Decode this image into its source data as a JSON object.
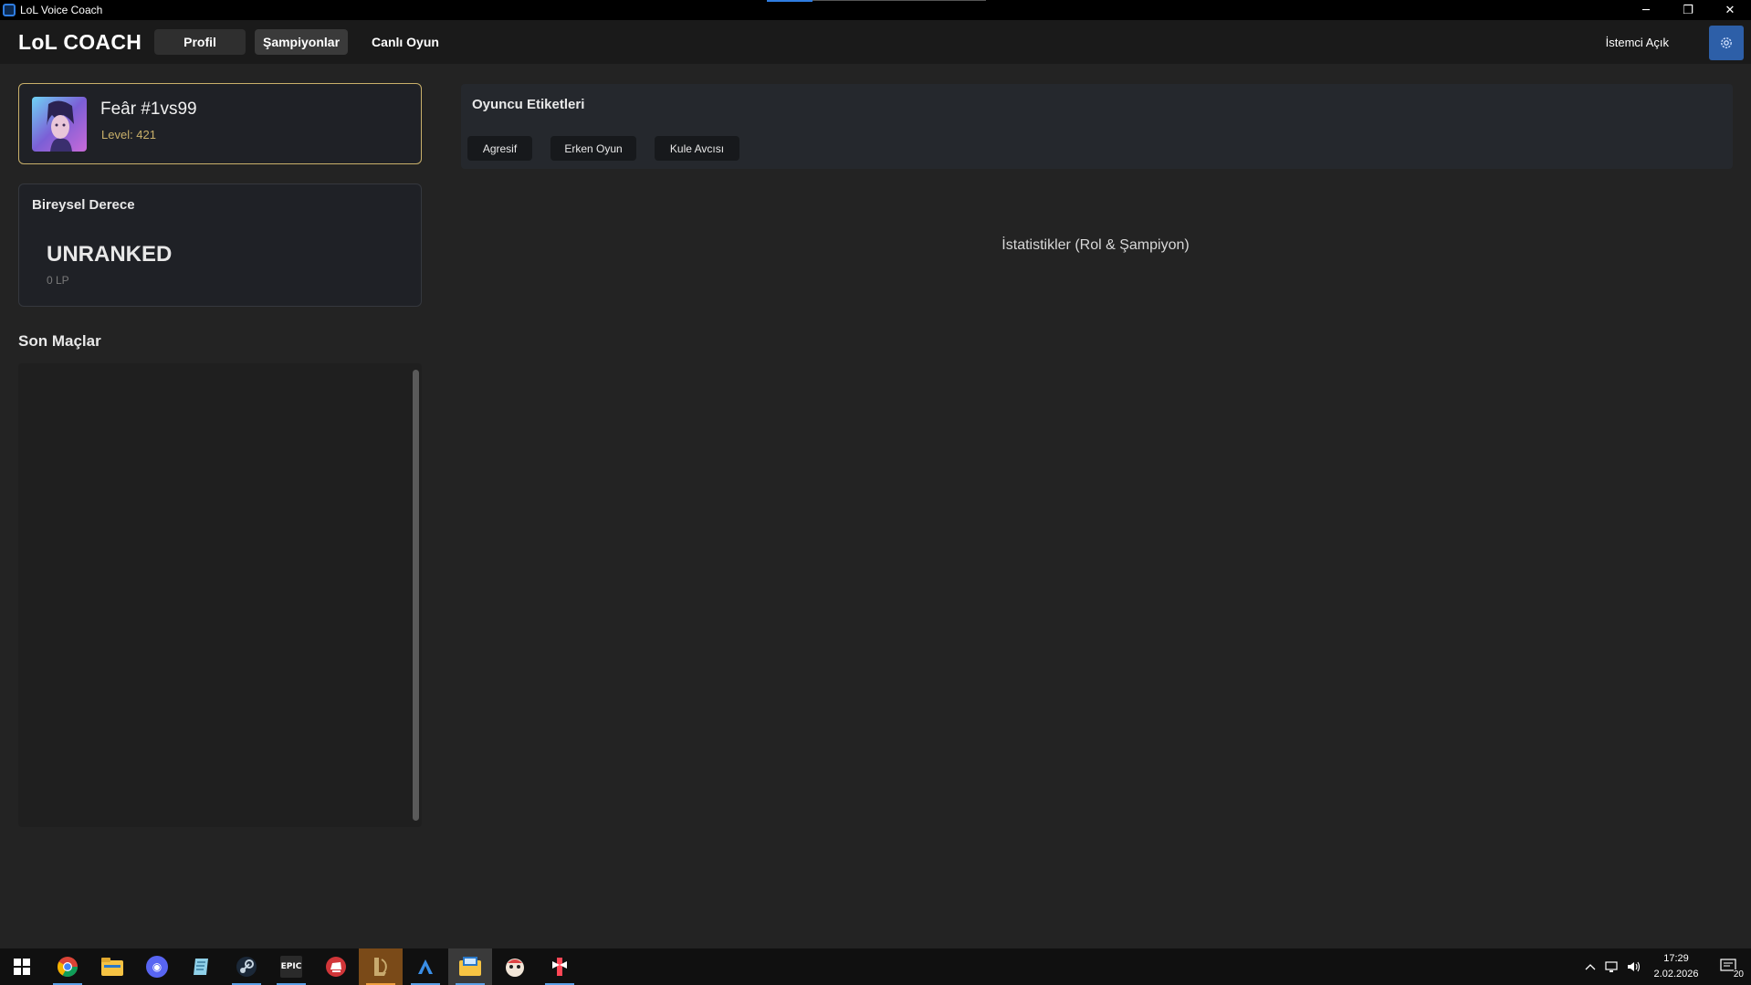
{
  "window": {
    "title": "LoL Voice Coach",
    "minimize": "─",
    "maximize": "❐",
    "close": "✕"
  },
  "nav": {
    "logo": "LoL COACH",
    "tabs": [
      {
        "label": "Profil"
      },
      {
        "label": "Şampiyonlar"
      },
      {
        "label": "Canlı Oyun"
      }
    ],
    "client_status": "İstemci Açık",
    "settings_icon": "gear-icon"
  },
  "profile": {
    "name": "Feâr #1vs99",
    "level": "Level: 421"
  },
  "rank": {
    "title": "Bireysel Derece",
    "tier": "UNRANKED",
    "lp": "0 LP"
  },
  "matches": {
    "title": "Son Maçlar"
  },
  "tags": {
    "title": "Oyuncu Etiketleri",
    "items": [
      "Agresif",
      "Erken Oyun",
      "Kule Avcısı"
    ]
  },
  "stats": {
    "title": "İstatistikler (Rol & Şampiyon)"
  },
  "taskbar": {
    "icons": [
      "windows-start-icon",
      "chrome-icon",
      "file-explorer-icon",
      "discord-icon",
      "notepad-icon",
      "steam-icon",
      "epic-games-icon",
      "riot-client-icon",
      "league-client-icon",
      "app-a-icon",
      "lol-voice-coach-icon",
      "game-pet-icon",
      "valorant-icon"
    ],
    "epic_label": "EPIC",
    "clock_time": "17:29",
    "clock_date": "2.02.2026",
    "notification_count": "20",
    "colors": {
      "accent": "#5aa0e6"
    }
  }
}
